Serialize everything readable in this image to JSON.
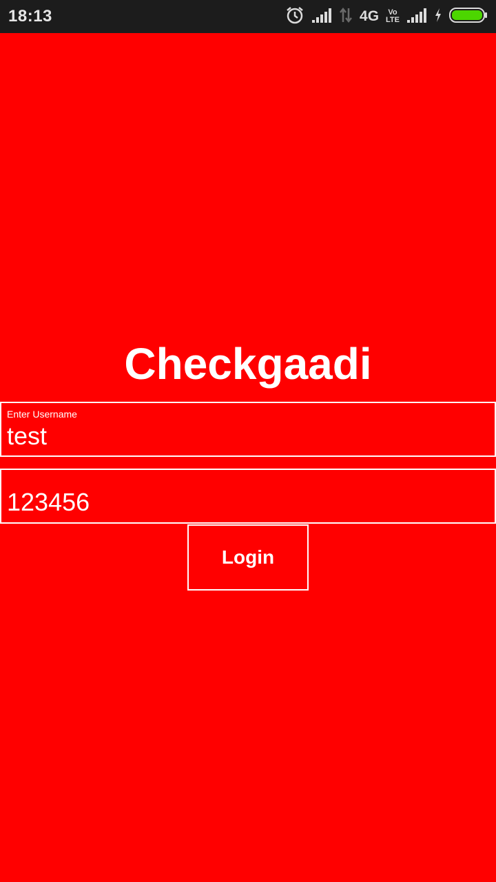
{
  "status_bar": {
    "time": "18:13",
    "network": "4G",
    "volte_top": "Vo",
    "volte_bottom": "LTE",
    "icons": [
      "alarm-icon",
      "signal-icon",
      "data-arrows-icon",
      "volte-icon",
      "signal-icon",
      "charging-icon",
      "battery-icon"
    ],
    "battery_level": 1.0,
    "battery_color": "#4cd600"
  },
  "app": {
    "title": "Checkgaadi",
    "background_color": "#ff0000"
  },
  "username": {
    "label": "Enter Username",
    "value": "test"
  },
  "password": {
    "value": "123456"
  },
  "login_button": {
    "label": "Login"
  }
}
